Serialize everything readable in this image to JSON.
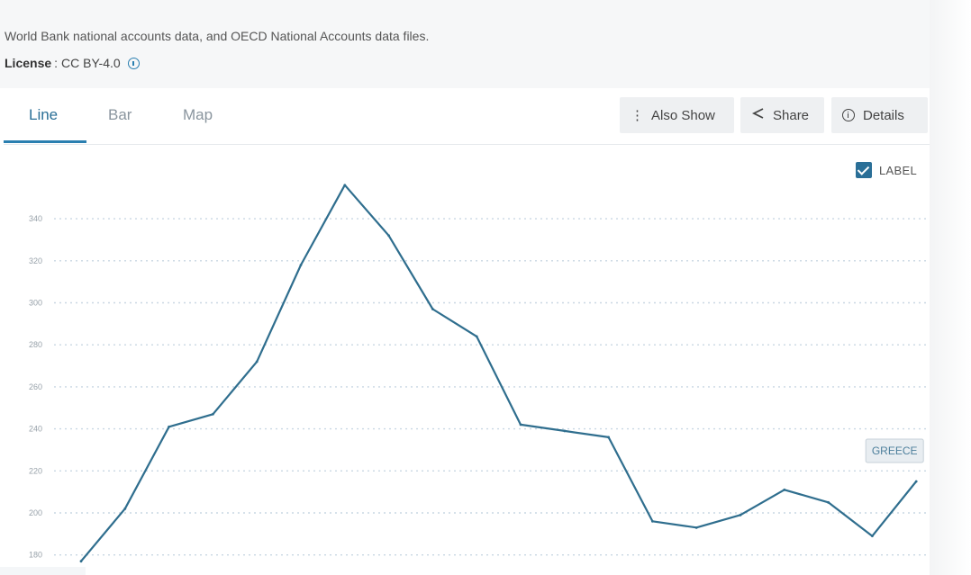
{
  "header": {
    "description": "World Bank national accounts data, and OECD National Accounts data files.",
    "license_label": "License",
    "license_value": "CC BY-4.0"
  },
  "tabs": [
    {
      "label": "Line",
      "active": true
    },
    {
      "label": "Bar",
      "active": false
    },
    {
      "label": "Map",
      "active": false
    }
  ],
  "toolbar": {
    "also_show": "Also Show",
    "share": "Share",
    "details": "Details"
  },
  "label_toggle": {
    "text": "LABEL",
    "checked": true
  },
  "chart_data": {
    "type": "line",
    "title": "",
    "xlabel": "",
    "ylabel": "",
    "ylim": [
      180,
      350
    ],
    "yticks": [
      180,
      200,
      220,
      240,
      260,
      280,
      300,
      320,
      340
    ],
    "grid": true,
    "series": [
      {
        "name": "GREECE",
        "color": "#2f6e8e",
        "values": [
          177,
          202,
          241,
          247,
          272,
          318,
          356,
          332,
          297,
          284,
          242,
          239,
          236,
          196,
          193,
          199,
          211,
          205,
          189,
          215
        ]
      }
    ]
  }
}
